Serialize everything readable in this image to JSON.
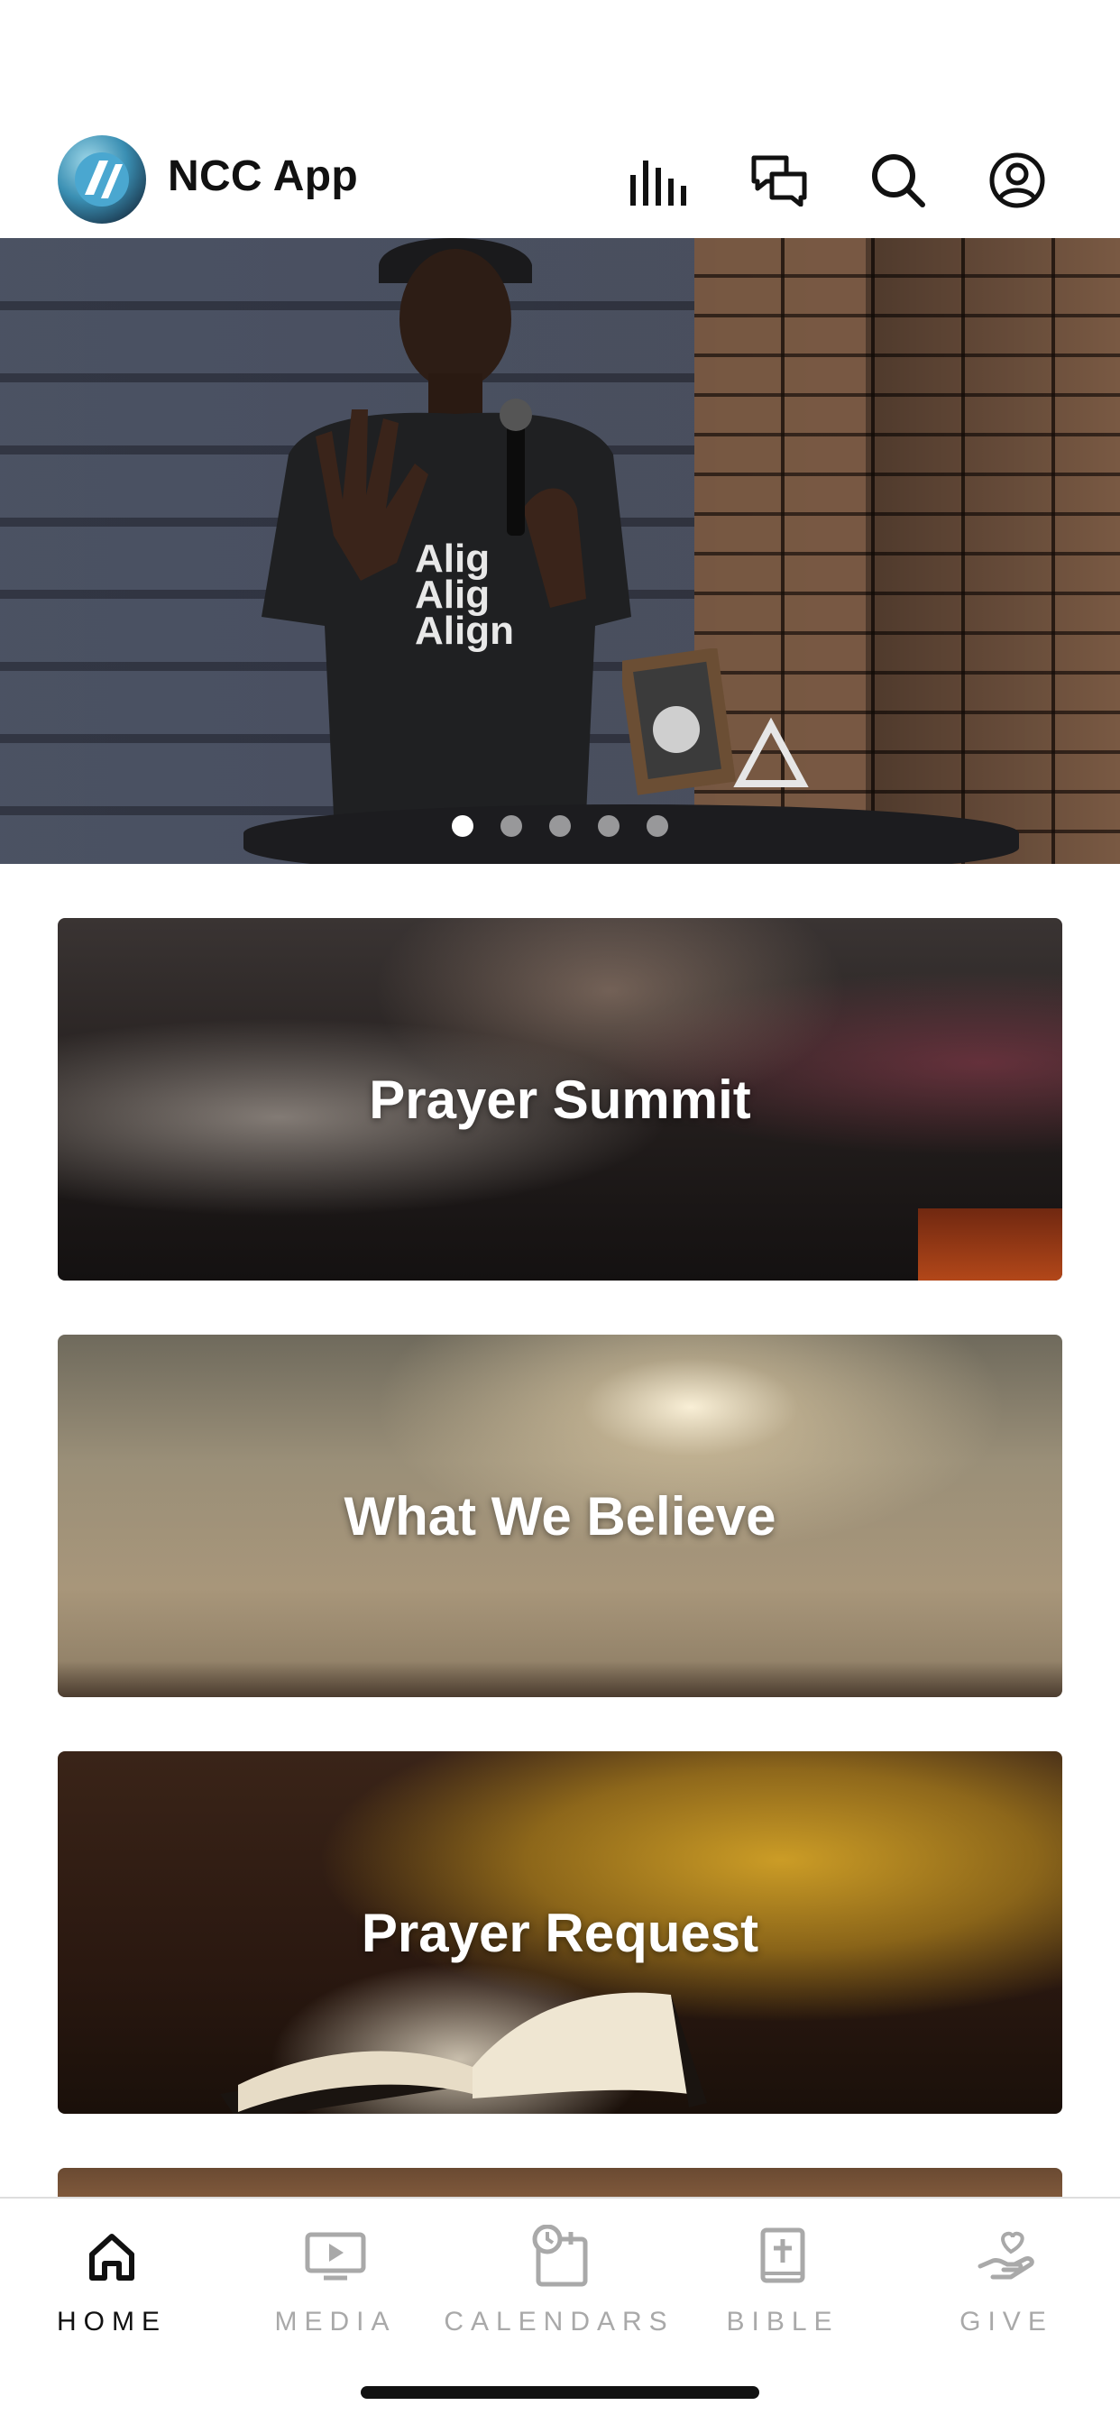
{
  "header": {
    "app_title": "NCC App",
    "icons": [
      "equalizer-icon",
      "chat-icon",
      "search-icon",
      "profile-icon"
    ]
  },
  "carousel": {
    "slide_count": 5,
    "active_index": 0
  },
  "cards": [
    {
      "title": "Prayer Summit"
    },
    {
      "title": "What We Believe"
    },
    {
      "title": "Prayer Request"
    },
    {
      "title": ""
    }
  ],
  "tabbar": {
    "tabs": [
      {
        "label": "HOME",
        "icon": "home-icon",
        "active": true
      },
      {
        "label": "MEDIA",
        "icon": "media-icon",
        "active": false
      },
      {
        "label": "CALENDARS",
        "icon": "calendar-icon",
        "active": false
      },
      {
        "label": "BIBLE",
        "icon": "bible-icon",
        "active": false
      },
      {
        "label": "GIVE",
        "icon": "give-icon",
        "active": false
      }
    ]
  },
  "colors": {
    "active_tab": "#111111",
    "inactive_tab": "#a9a9a9",
    "background": "#ffffff"
  }
}
